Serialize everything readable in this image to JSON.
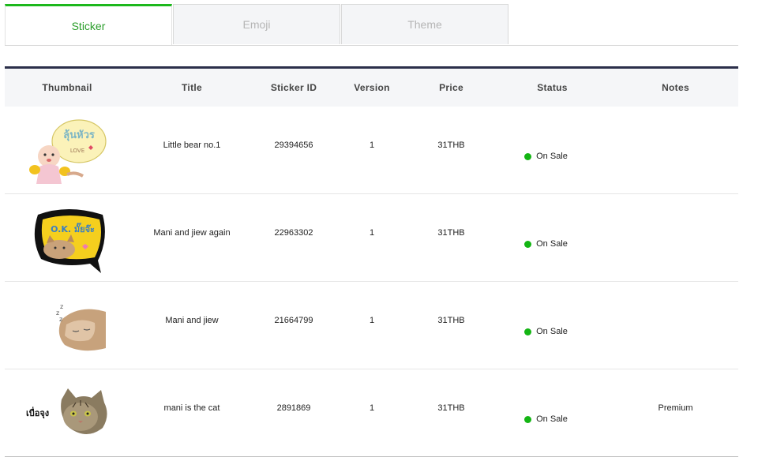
{
  "tabs": [
    {
      "label": "Sticker",
      "active": true
    },
    {
      "label": "Emoji",
      "active": false
    },
    {
      "label": "Theme",
      "active": false
    }
  ],
  "table": {
    "headers": [
      "Thumbnail",
      "Title",
      "Sticker ID",
      "Version",
      "Price",
      "Status",
      "Notes"
    ],
    "rows": [
      {
        "thumbnail": "baby-sticker-thumbnail",
        "title": "Little bear no.1",
        "sticker_id": "29394656",
        "version": "1",
        "price": "31THB",
        "status": "On Sale",
        "notes": ""
      },
      {
        "thumbnail": "cat-ok-sticker-thumbnail",
        "title": "Mani and jiew again",
        "sticker_id": "22963302",
        "version": "1",
        "price": "31THB",
        "status": "On Sale",
        "notes": ""
      },
      {
        "thumbnail": "sleeping-cat-sticker-thumbnail",
        "title": "Mani and jiew",
        "sticker_id": "21664799",
        "version": "1",
        "price": "31THB",
        "status": "On Sale",
        "notes": ""
      },
      {
        "thumbnail": "cat-face-sticker-thumbnail",
        "thumb_text": "เบื่อจุง",
        "title": "mani is the cat",
        "sticker_id": "2891869",
        "version": "1",
        "price": "31THB",
        "status": "On Sale",
        "notes": "Premium"
      }
    ]
  },
  "thumb_texts": {
    "baby_bubble": "ลุ้นหัวร",
    "baby_small": "LOVE",
    "ok_bubble": "O.K. มั๊ยจ๊ะ"
  },
  "colors": {
    "accent": "#1cb81c",
    "header_border": "#2b2f4a",
    "status_on_sale": "#14b514"
  }
}
